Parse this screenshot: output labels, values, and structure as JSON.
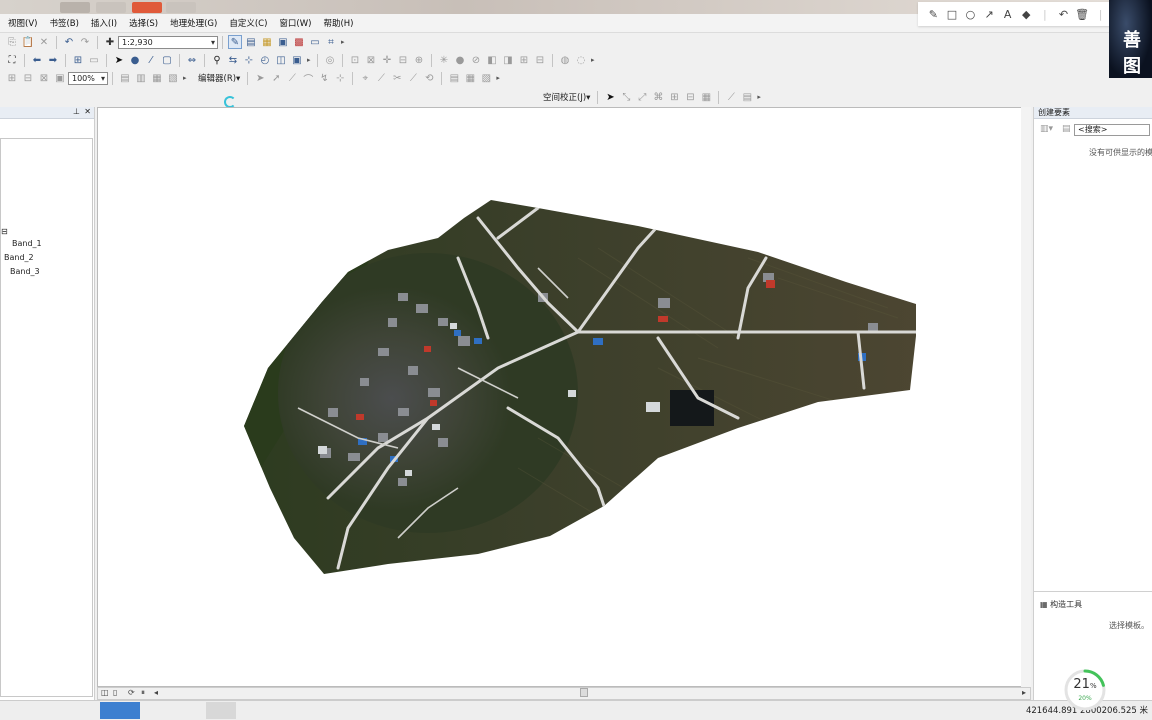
{
  "menubar": {
    "items": [
      "视图(V)",
      "书签(B)",
      "插入(I)",
      "选择(S)",
      "地理处理(G)",
      "自定义(C)",
      "窗口(W)",
      "帮助(H)"
    ]
  },
  "toolbar1": {
    "scale_value": "1:2,930"
  },
  "toolbar2": {
    "zoom_value": "100%",
    "editor_label": "编辑器(R)▾"
  },
  "toolbar3": {
    "georef_label": "空间校正(J)▾"
  },
  "brand": {
    "text": "善图"
  },
  "toc": {
    "bands": [
      "Band_1",
      "Band_2",
      "Band_3"
    ]
  },
  "right_panel": {
    "title": "创建要素",
    "search_placeholder": "<搜索>",
    "empty_message": "没有可供显示的模",
    "tools_header": "构造工具",
    "no_tool_message": "选择模板。"
  },
  "status": {
    "coords": "421644.891 2800206.525 米"
  },
  "progress": {
    "percent": 21,
    "unit": "%",
    "sub": "20%"
  },
  "colors": {
    "accent": "#3a5d8f",
    "ring": "#43c35a",
    "menu_bg": "#f3f3f3"
  }
}
